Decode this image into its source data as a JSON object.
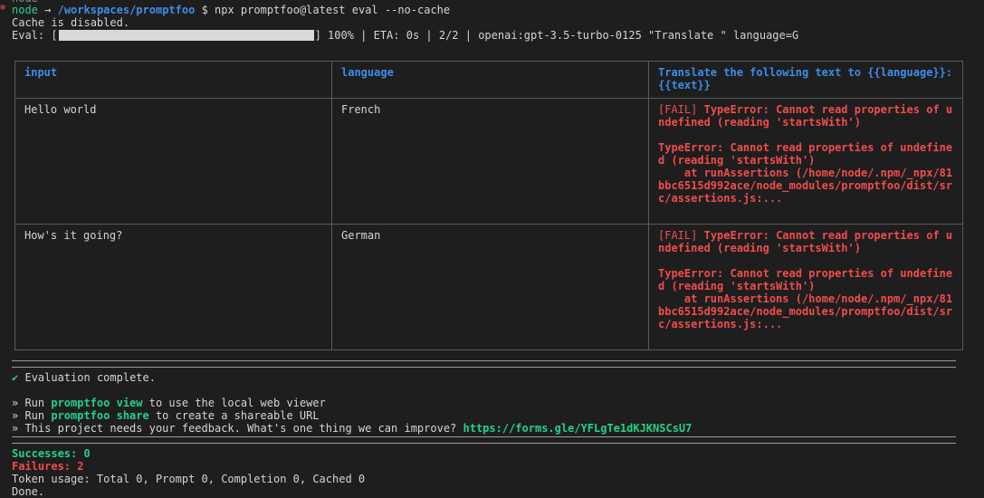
{
  "terminal": {
    "topcut": "node",
    "prompt_user": "node",
    "prompt_arrow": "→",
    "prompt_path": "/workspaces/promptfoo",
    "prompt_symbol": "$",
    "command": "npx promptfoo@latest eval --no-cache",
    "cache_msg": "Cache is disabled.",
    "eval_prefix": "Eval: [",
    "eval_suffix": "] 100% | ETA: 0s | 2/2 | openai:gpt-3.5-turbo-0125 \"Translate \" language=G",
    "progress_percent": 100
  },
  "table": {
    "headers": [
      "input",
      "language",
      "Translate the following text to {{language}}: {{text}}"
    ],
    "rows": [
      {
        "input": "Hello world",
        "language": "French",
        "fail_tag": "[FAIL]",
        "fail_msg": "TypeError: Cannot read properties of undefined (reading 'startsWith')",
        "error_detail": "TypeError: Cannot read properties of undefined (reading 'startsWith')",
        "stack": "    at runAssertions (/home/node/.npm/_npx/81bbc6515d992ace/node_modules/promptfoo/dist/src/assertions.js:..."
      },
      {
        "input": "How's it going?",
        "language": "German",
        "fail_tag": "[FAIL]",
        "fail_msg": "TypeError: Cannot read properties of undefined (reading 'startsWith')",
        "error_detail": "TypeError: Cannot read properties of undefined (reading 'startsWith')",
        "stack": "    at runAssertions (/home/node/.npm/_npx/81bbc6515d992ace/node_modules/promptfoo/dist/src/assertions.js:..."
      }
    ]
  },
  "summary": {
    "check_icon": "✔",
    "complete": "Evaluation complete.",
    "tip1_prefix": "» Run ",
    "tip1_cmd": "promptfoo view",
    "tip1_suffix": " to use the local web viewer",
    "tip2_prefix": "» Run ",
    "tip2_cmd": "promptfoo share",
    "tip2_suffix": " to create a shareable URL",
    "tip3_prefix": "» This project needs your feedback. What's one thing we can improve? ",
    "feedback_url": "https://forms.gle/YFLgTe1dKJKNSCsU7",
    "successes": "Successes: 0",
    "failures": "Failures: 2",
    "tokens": "Token usage: Total 0, Prompt 0, Completion 0, Cached 0",
    "done": "Done."
  },
  "colors": {
    "background": "#1e1e1e",
    "green": "#23d18b",
    "blue": "#3b8eea",
    "red": "#f14c4c"
  }
}
